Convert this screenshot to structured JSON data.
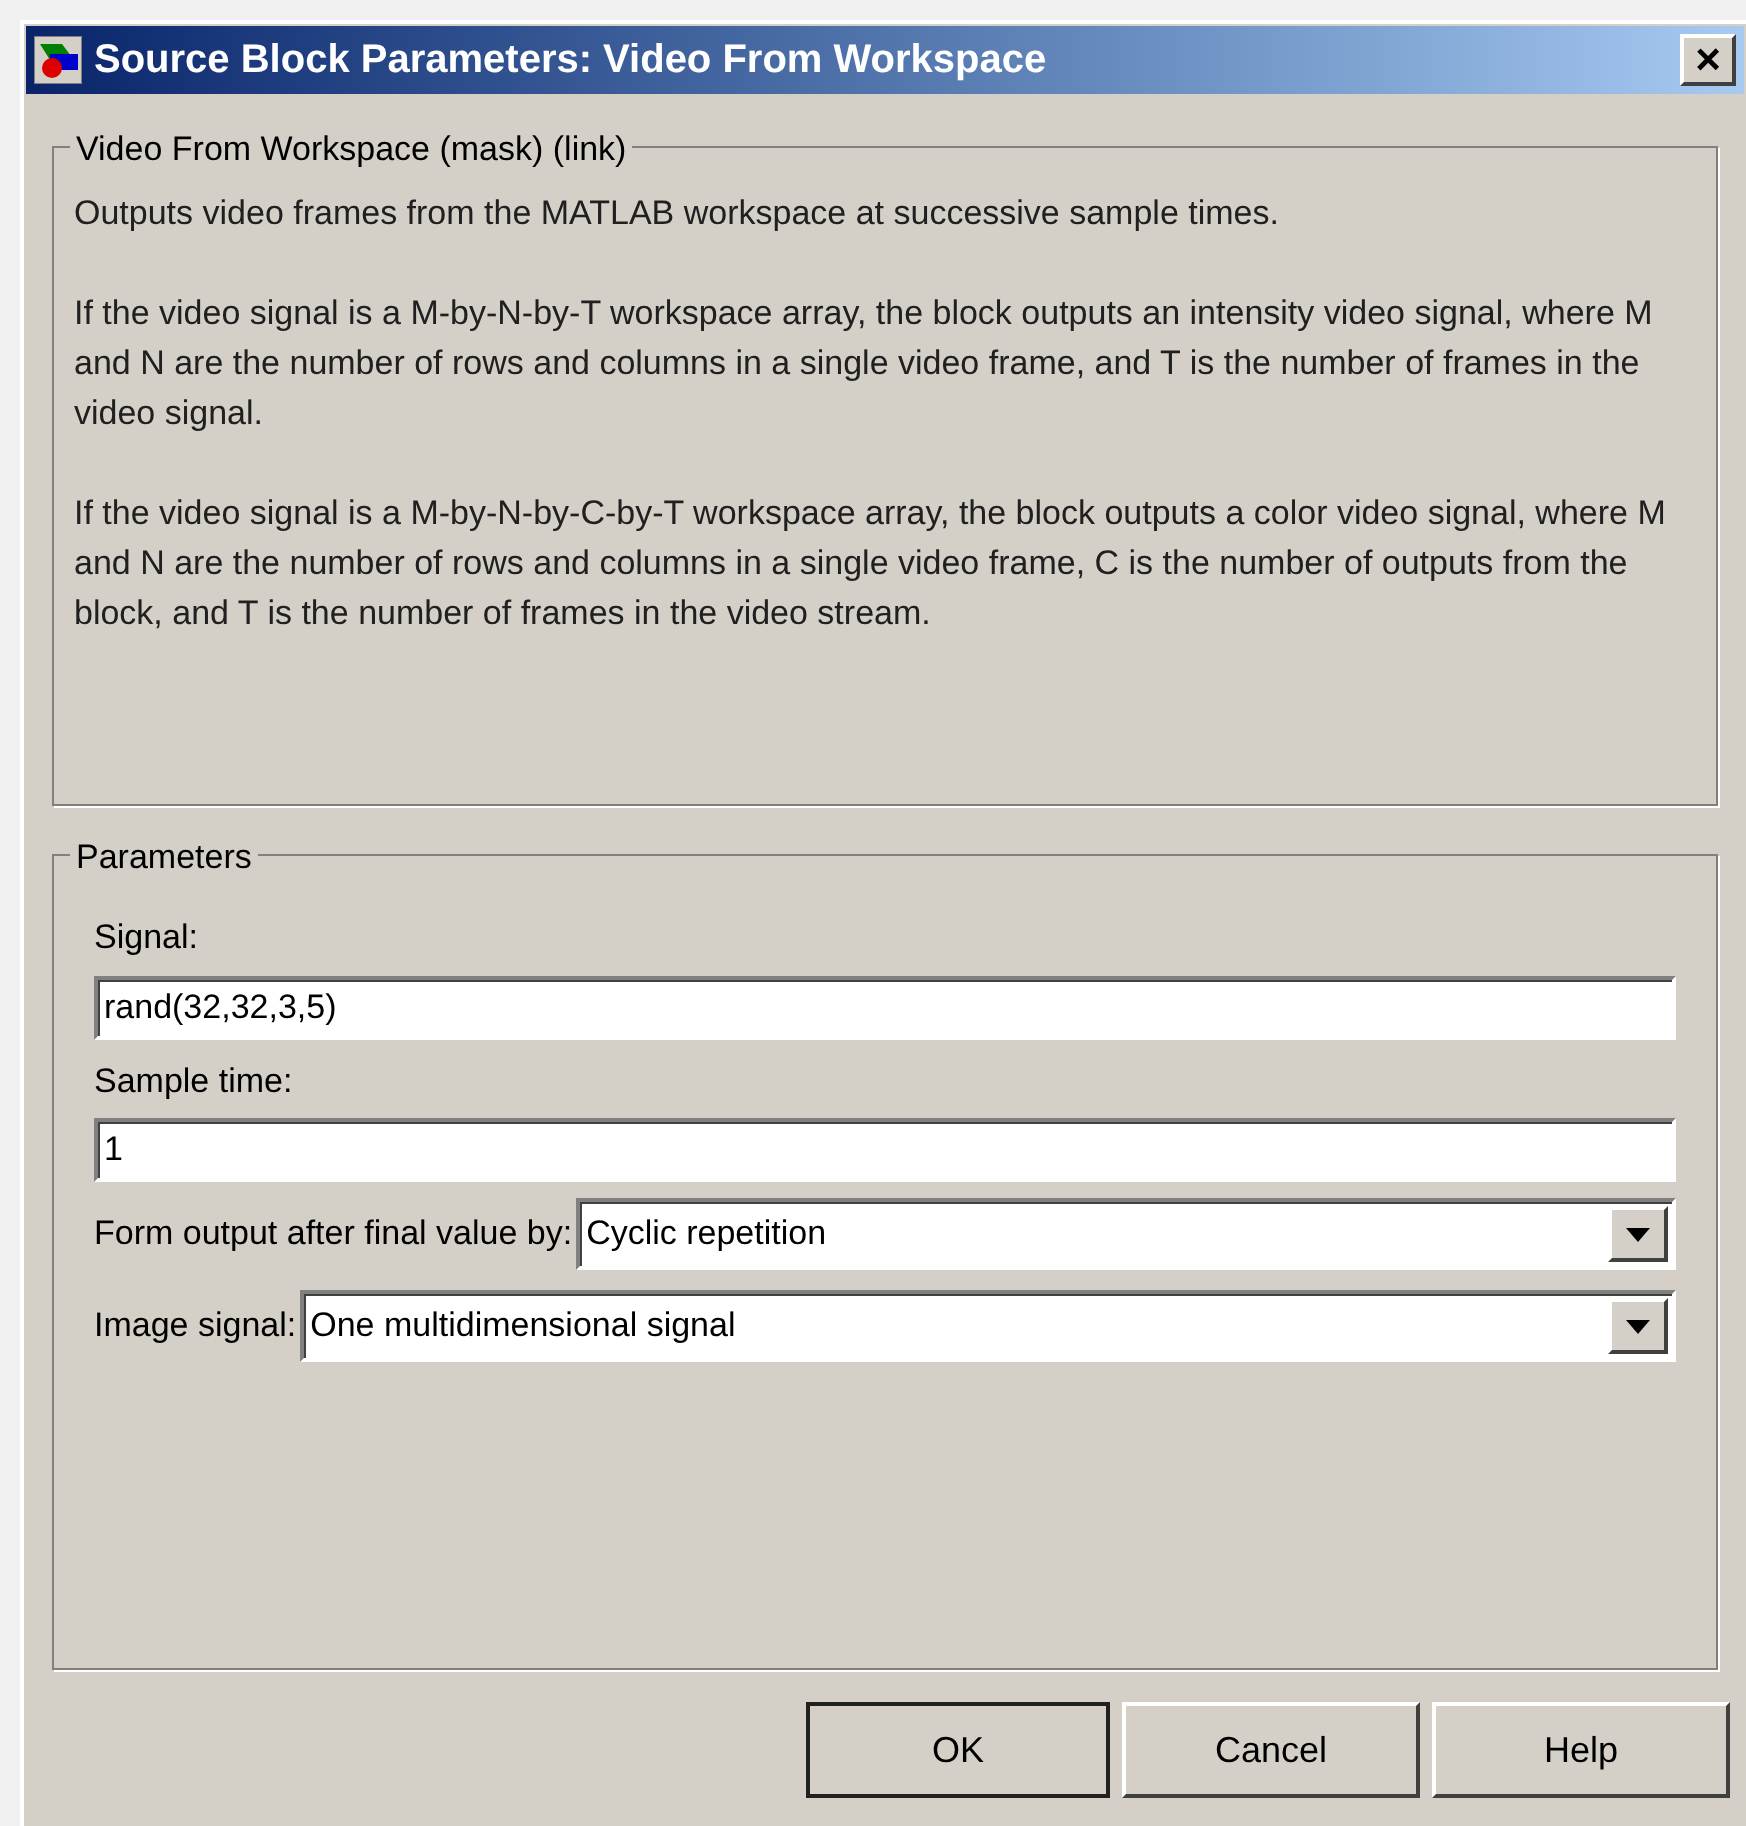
{
  "window": {
    "title": "Source Block Parameters: Video From Workspace",
    "close": "×"
  },
  "description": {
    "title": "Video From Workspace (mask) (link)",
    "paragraphs": [
      "Outputs video frames from the MATLAB workspace at successive sample times.",
      "If the video signal is a M-by-N-by-T workspace array, the block outputs an intensity video signal, where M and N are the number of rows and columns in a single video frame, and T is the number of frames in the video signal.",
      "If the video signal is a M-by-N-by-C-by-T workspace array, the block outputs a color video signal, where M and N are the number of rows and columns in a single video frame, C is the number of outputs from the block, and T is the number of frames in the video stream."
    ]
  },
  "parameters": {
    "title": "Parameters",
    "fields": [
      {
        "kind": "text",
        "label": "Signal:",
        "value": "rand(32,32,3,5)"
      },
      {
        "kind": "text",
        "label": "Sample time:",
        "value": "1"
      },
      {
        "kind": "dropdown",
        "label": "Form output after final value by:",
        "value": "Cyclic repetition"
      },
      {
        "kind": "dropdown",
        "label": "Image signal:",
        "value": "One multidimensional signal"
      }
    ]
  },
  "buttons": [
    "OK",
    "Cancel",
    "Help"
  ]
}
